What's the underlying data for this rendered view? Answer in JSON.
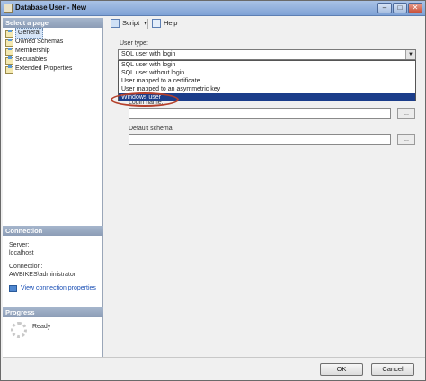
{
  "window": {
    "title": "Database User - New",
    "minimize_glyph": "–",
    "maximize_glyph": "□",
    "close_glyph": "✕"
  },
  "select_page": {
    "header": "Select a page",
    "items": [
      {
        "label": "General",
        "selected": true
      },
      {
        "label": "Owned Schemas",
        "selected": false
      },
      {
        "label": "Membership",
        "selected": false
      },
      {
        "label": "Securables",
        "selected": false
      },
      {
        "label": "Extended Properties",
        "selected": false
      }
    ]
  },
  "connection": {
    "header": "Connection",
    "server_label": "Server:",
    "server_value": "localhost",
    "connection_label": "Connection:",
    "connection_value": "AWBIKES\\administrator",
    "view_link": "View connection properties"
  },
  "progress": {
    "header": "Progress",
    "status": "Ready"
  },
  "toolbar": {
    "script_label": "Script",
    "script_arrow": "▾",
    "help_label": "Help"
  },
  "form": {
    "user_type_label": "User type:",
    "user_type_value": "SQL user with login",
    "combo_arrow": "▼",
    "dropdown_options": [
      "SQL user with login",
      "SQL user without login",
      "User mapped to a certificate",
      "User mapped to an asymmetric key",
      "Windows user"
    ],
    "dropdown_selected": "Windows user",
    "partial_label": "Login name:",
    "login_name_value": "",
    "default_schema_label": "Default schema:",
    "default_schema_value": "",
    "ellipsis_label": "..."
  },
  "buttons": {
    "ok": "OK",
    "cancel": "Cancel"
  },
  "colors": {
    "selection": "#1b3d8a",
    "link": "#1a4fb5",
    "annotation_ring": "#b4402b"
  }
}
